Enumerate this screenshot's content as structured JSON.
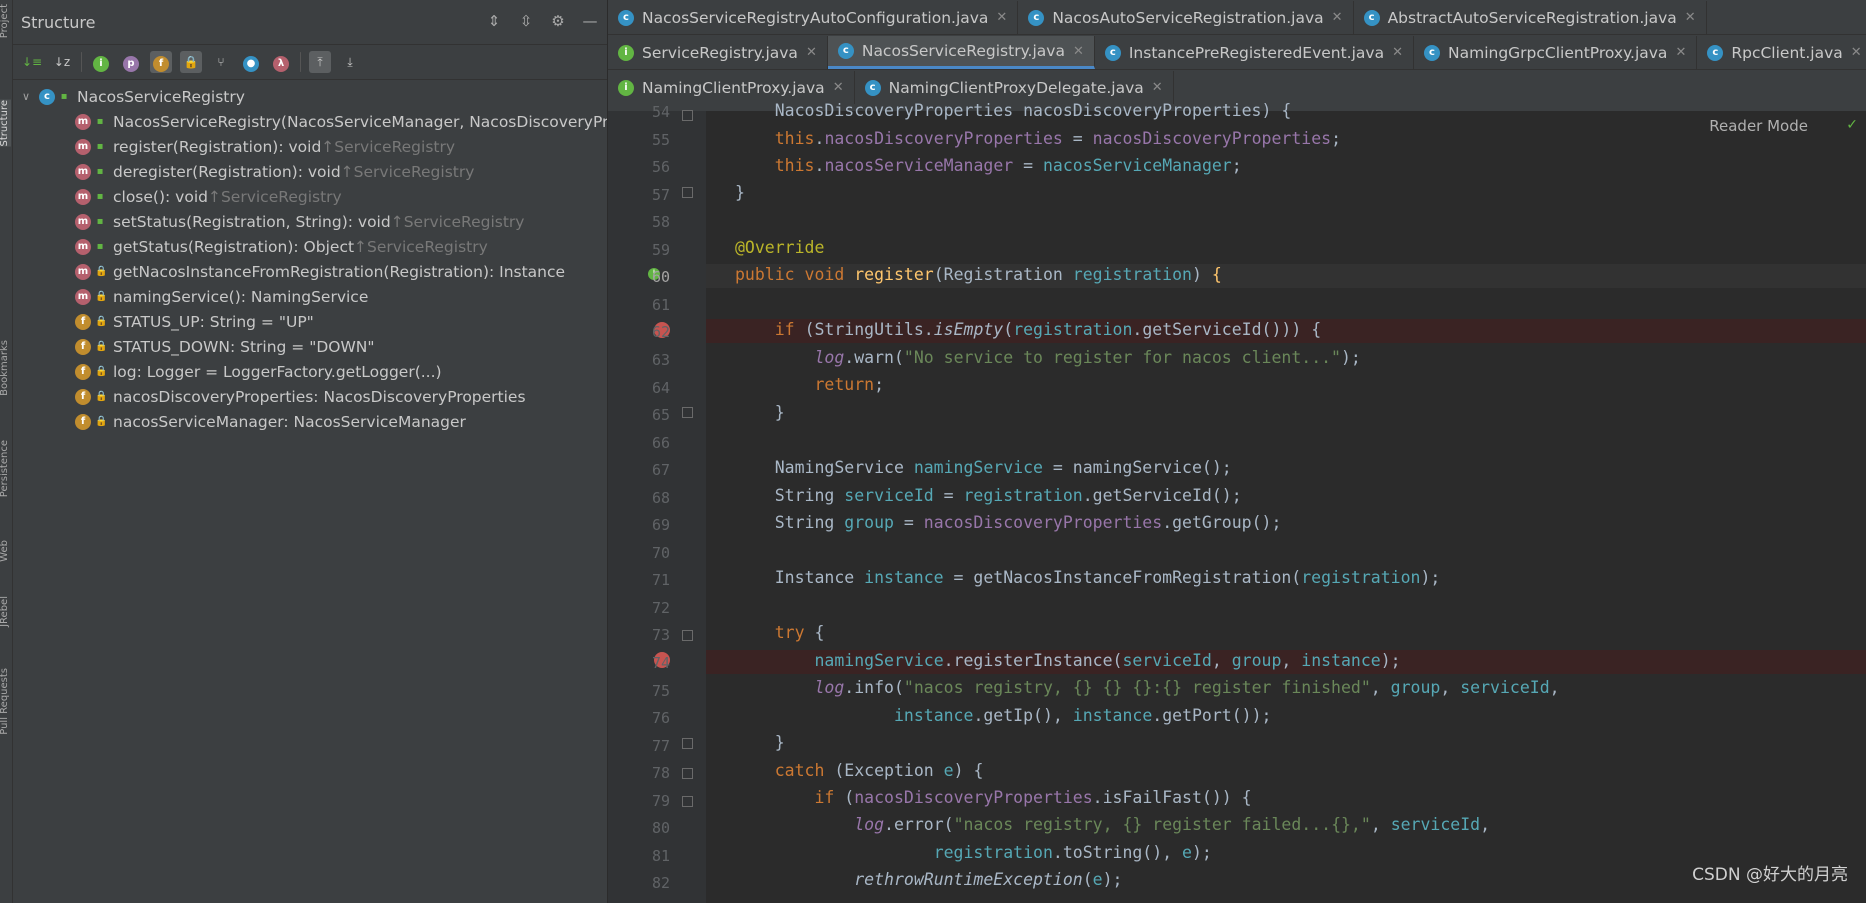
{
  "left_strip": {
    "tabs": [
      "Project",
      "Structure",
      "Bookmarks",
      "Persistence",
      "Web",
      "JRebel",
      "Pull Requests"
    ]
  },
  "structure": {
    "title": "Structure",
    "header_icons": [
      "expand-all-icon",
      "collapse-all-icon",
      "gear-icon",
      "minimize-icon"
    ],
    "toolbar_icons": [
      "sort-visibility-icon",
      "sort-alpha-icon",
      "show-inherited-icon",
      "show-properties-icon",
      "show-fields-icon",
      "show-non-public-icon",
      "show-anonymous-icon",
      "show-lambdas-icon",
      "show-closures-icon",
      "autoscroll-to-source-icon",
      "autoscroll-from-source-icon"
    ],
    "root": "NacosServiceRegistry",
    "items": [
      {
        "badge": "m",
        "vis": "pub",
        "text": "NacosServiceRegistry(NacosServiceManager, NacosDiscoveryPrope",
        "suffix": ""
      },
      {
        "badge": "m",
        "vis": "pub",
        "text": "register(Registration): void ",
        "suffix": "↑ServiceRegistry"
      },
      {
        "badge": "m",
        "vis": "pub",
        "text": "deregister(Registration): void ",
        "suffix": "↑ServiceRegistry"
      },
      {
        "badge": "m",
        "vis": "pub",
        "text": "close(): void ",
        "suffix": "↑ServiceRegistry"
      },
      {
        "badge": "m",
        "vis": "pub",
        "text": "setStatus(Registration, String): void ",
        "suffix": "↑ServiceRegistry"
      },
      {
        "badge": "m",
        "vis": "pub",
        "text": "getStatus(Registration): Object ",
        "suffix": "↑ServiceRegistry"
      },
      {
        "badge": "m",
        "vis": "priv",
        "text": "getNacosInstanceFromRegistration(Registration): Instance",
        "suffix": ""
      },
      {
        "badge": "m",
        "vis": "priv",
        "text": "namingService(): NamingService",
        "suffix": ""
      },
      {
        "badge": "f",
        "vis": "priv",
        "text": "STATUS_UP: String = \"UP\"",
        "suffix": ""
      },
      {
        "badge": "f",
        "vis": "priv",
        "text": "STATUS_DOWN: String = \"DOWN\"",
        "suffix": ""
      },
      {
        "badge": "f",
        "vis": "priv",
        "text": "log: Logger = LoggerFactory.getLogger(...)",
        "suffix": ""
      },
      {
        "badge": "f",
        "vis": "priv",
        "text": "nacosDiscoveryProperties: NacosDiscoveryProperties",
        "suffix": ""
      },
      {
        "badge": "f",
        "vis": "priv",
        "text": "nacosServiceManager: NacosServiceManager",
        "suffix": ""
      }
    ]
  },
  "tabs": {
    "row1": [
      "NacosServiceRegistryAutoConfiguration.java",
      "NacosAutoServiceRegistration.java",
      "AbstractAutoServiceRegistration.java"
    ],
    "row2": [
      "ServiceRegistry.java",
      "NacosServiceRegistry.java",
      "InstancePreRegisteredEvent.java",
      "NamingGrpcClientProxy.java",
      "RpcClient.java"
    ],
    "row3": [
      "NamingClientProxy.java",
      "NamingClientProxyDelegate.java"
    ]
  },
  "editor": {
    "reader_mode": "Reader Mode",
    "line_numbers": [
      "54",
      "55",
      "56",
      "57",
      "58",
      "59",
      "60",
      "61",
      "62",
      "63",
      "64",
      "65",
      "66",
      "67",
      "68",
      "69",
      "70",
      "71",
      "72",
      "73",
      "74",
      "75",
      "76",
      "77",
      "78",
      "79",
      "80",
      "81",
      "82"
    ]
  },
  "watermark": "CSDN @好大的月亮"
}
